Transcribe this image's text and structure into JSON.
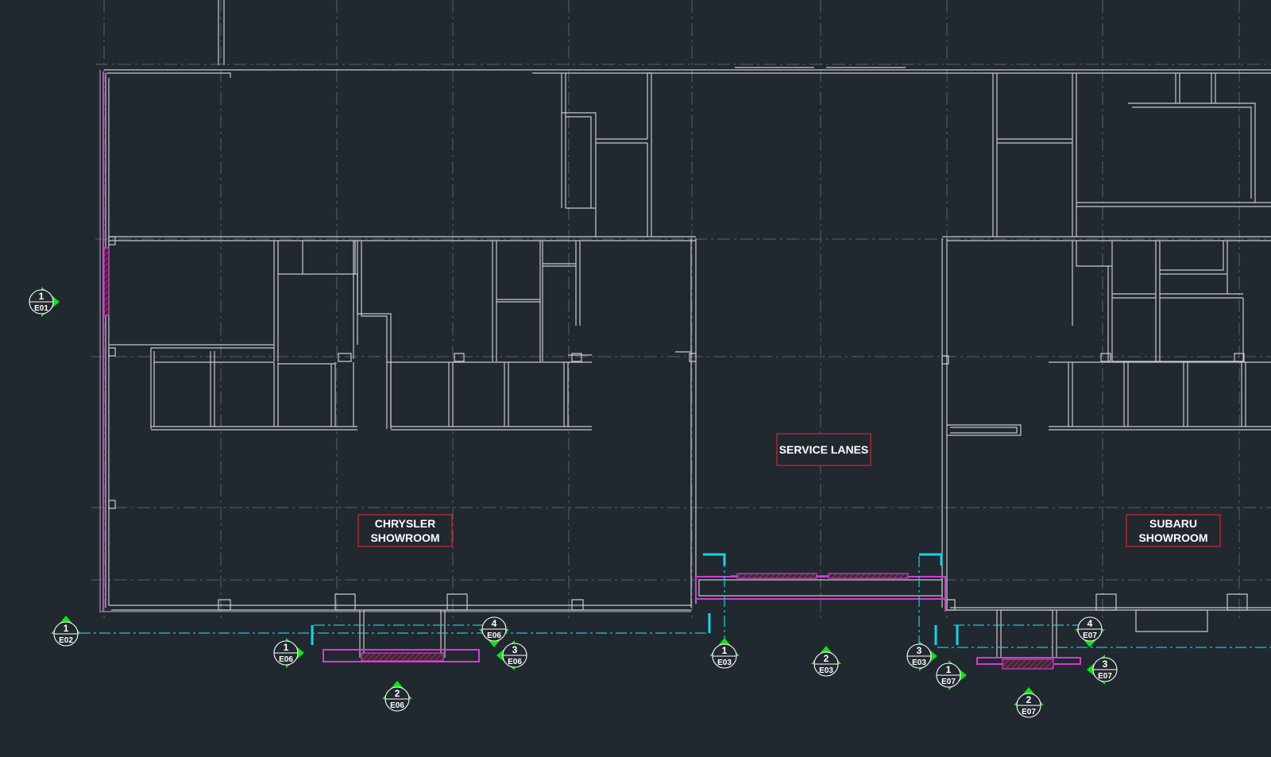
{
  "drawing": {
    "rooms": [
      {
        "id": "chrysler",
        "lines": [
          "CHRYSLER",
          "SHOWROOM"
        ]
      },
      {
        "id": "service",
        "lines": [
          "SERVICE LANES"
        ]
      },
      {
        "id": "subaru",
        "lines": [
          "SUBARU",
          "SHOWROOM"
        ]
      }
    ],
    "elevation_tags": [
      {
        "num": "1",
        "sheet": "E01",
        "point": "right"
      },
      {
        "num": "1",
        "sheet": "E02",
        "point": "up"
      },
      {
        "num": "1",
        "sheet": "E06",
        "point": "right"
      },
      {
        "num": "2",
        "sheet": "E06",
        "point": "up"
      },
      {
        "num": "3",
        "sheet": "E06",
        "point": "left"
      },
      {
        "num": "4",
        "sheet": "E06",
        "point": "down"
      },
      {
        "num": "1",
        "sheet": "E03",
        "point": "up"
      },
      {
        "num": "2",
        "sheet": "E03",
        "point": "up"
      },
      {
        "num": "3",
        "sheet": "E03",
        "point": "right"
      },
      {
        "num": "1",
        "sheet": "E07",
        "point": "right"
      },
      {
        "num": "2",
        "sheet": "E07",
        "point": "up"
      },
      {
        "num": "3",
        "sheet": "E07",
        "point": "left"
      },
      {
        "num": "4",
        "sheet": "E07",
        "point": "down"
      }
    ]
  },
  "colors": {
    "background": "#212830",
    "walls": "#c9c9c9",
    "grid": "#59606a",
    "storefront": "#d43bd4",
    "section_lines": "#13d6e6",
    "room_label_border": "#c8262e",
    "tag_arrow": "#12e112"
  }
}
